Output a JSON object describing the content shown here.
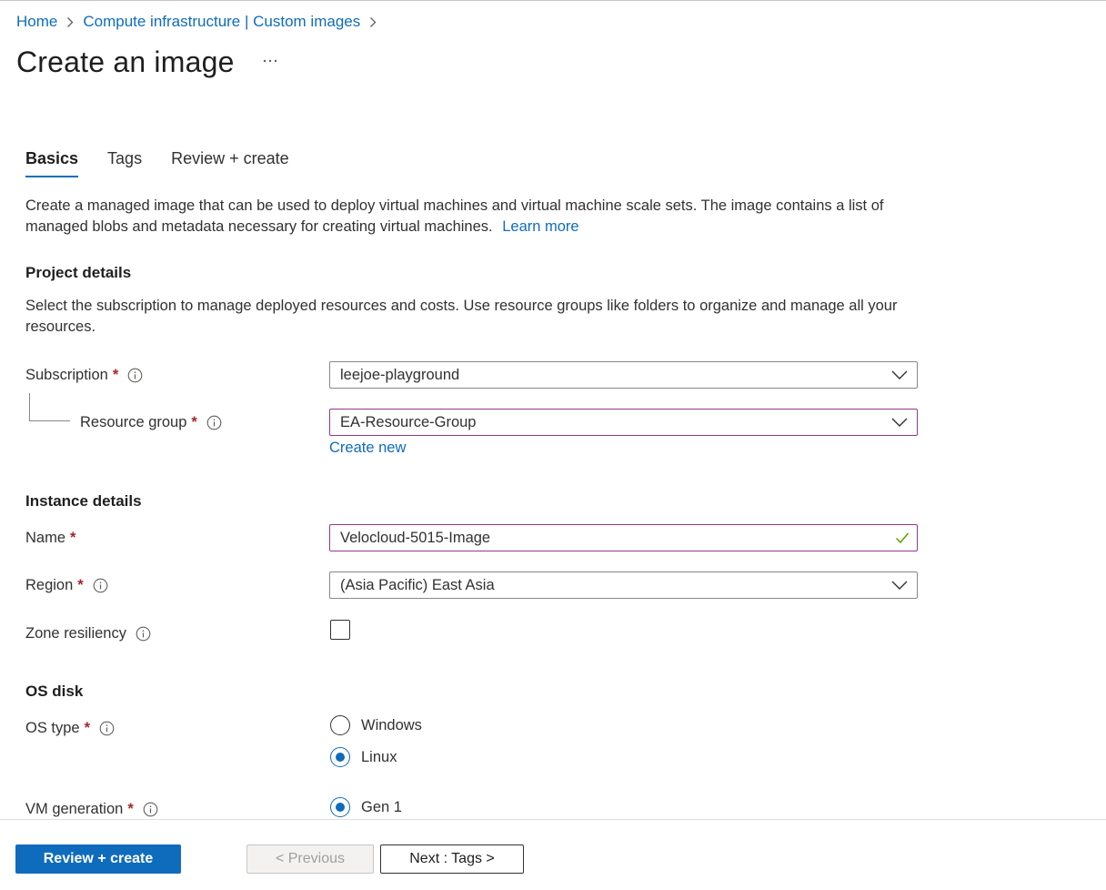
{
  "breadcrumb": {
    "items": [
      "Home",
      "Compute infrastructure | Custom images"
    ]
  },
  "page": {
    "title": "Create an image"
  },
  "tabs": [
    {
      "label": "Basics",
      "active": true
    },
    {
      "label": "Tags",
      "active": false
    },
    {
      "label": "Review + create",
      "active": false
    }
  ],
  "intro": {
    "text": "Create a managed image that can be used to deploy virtual machines and virtual machine scale sets. The image contains a list of managed blobs and metadata necessary for creating virtual machines.",
    "learn_more": "Learn more"
  },
  "project_details": {
    "title": "Project details",
    "description": "Select the subscription to manage deployed resources and costs. Use resource groups like folders to organize and manage all your resources.",
    "subscription_label": "Subscription",
    "subscription_value": "leejoe-playground",
    "resource_group_label": "Resource group",
    "resource_group_value": "EA-Resource-Group",
    "create_new": "Create new"
  },
  "instance_details": {
    "title": "Instance details",
    "name_label": "Name",
    "name_value": "Velocloud-5015-Image",
    "region_label": "Region",
    "region_value": "(Asia Pacific) East Asia",
    "zone_label": "Zone resiliency",
    "zone_checked": false
  },
  "os_disk": {
    "title": "OS disk",
    "os_type_label": "OS type",
    "os_options": [
      {
        "label": "Windows",
        "checked": false
      },
      {
        "label": "Linux",
        "checked": true
      }
    ],
    "vm_generation_label": "VM generation",
    "vm_generation_options": [
      {
        "label": "Gen 1",
        "checked": true
      }
    ]
  },
  "required_marker": "*",
  "footer": {
    "review_create": "Review + create",
    "previous": "< Previous",
    "next": "Next : Tags >"
  },
  "colors": {
    "accent": "#0f6cbd",
    "required": "#a4262c",
    "focus_border": "#8e3a8a",
    "valid": "#57a300"
  }
}
